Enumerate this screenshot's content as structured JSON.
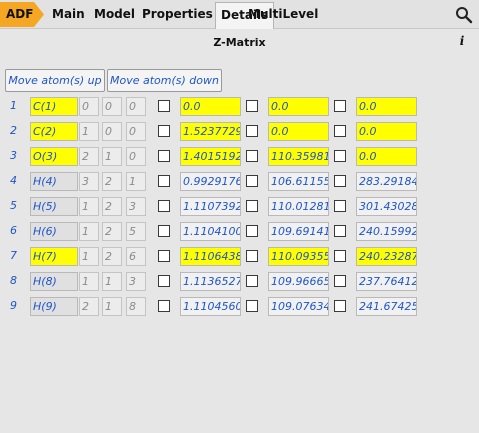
{
  "tabs": {
    "adf": "ADF",
    "items": [
      "Main",
      "Model",
      "Properties",
      "Details",
      "MultiLevel"
    ]
  },
  "panel": {
    "title": "Z-Matrix",
    "info": "i"
  },
  "toolbar": {
    "move_up": "Move atom(s) up",
    "move_down": "Move atom(s) down"
  },
  "colors": {
    "highlight": "#ffff00",
    "link_blue": "#1f55c8",
    "adf_orange": "#f5a623"
  },
  "rows": [
    {
      "n": "1",
      "atom": "C(1)",
      "r1": "0",
      "r2": "0",
      "r3": "0",
      "dist": "0.0",
      "angle": "0.0",
      "dihedral": "0.0",
      "hl_atom": true,
      "hl_dist": true,
      "hl_angle": true,
      "hl_dihedral": true
    },
    {
      "n": "2",
      "atom": "C(2)",
      "r1": "1",
      "r2": "0",
      "r3": "0",
      "dist": "1.5237729",
      "angle": "0.0",
      "dihedral": "0.0",
      "hl_atom": true,
      "hl_dist": true,
      "hl_angle": true,
      "hl_dihedral": true
    },
    {
      "n": "3",
      "atom": "O(3)",
      "r1": "2",
      "r2": "1",
      "r3": "0",
      "dist": "1.4015192",
      "angle": "110.35981",
      "dihedral": "0.0",
      "hl_atom": true,
      "hl_dist": true,
      "hl_angle": true,
      "hl_dihedral": true
    },
    {
      "n": "4",
      "atom": "H(4)",
      "r1": "3",
      "r2": "2",
      "r3": "1",
      "dist": "0.9929176",
      "angle": "106.61155",
      "dihedral": "283.29184",
      "hl_atom": false,
      "hl_dist": false,
      "hl_angle": false,
      "hl_dihedral": false
    },
    {
      "n": "5",
      "atom": "H(5)",
      "r1": "1",
      "r2": "2",
      "r3": "3",
      "dist": "1.1107392",
      "angle": "110.01281",
      "dihedral": "301.43028",
      "hl_atom": false,
      "hl_dist": false,
      "hl_angle": false,
      "hl_dihedral": false
    },
    {
      "n": "6",
      "atom": "H(6)",
      "r1": "1",
      "r2": "2",
      "r3": "5",
      "dist": "1.1104100",
      "angle": "109.69141",
      "dihedral": "240.15992",
      "hl_atom": false,
      "hl_dist": false,
      "hl_angle": false,
      "hl_dihedral": false
    },
    {
      "n": "7",
      "atom": "H(7)",
      "r1": "1",
      "r2": "2",
      "r3": "6",
      "dist": "1.1106438",
      "angle": "110.09355",
      "dihedral": "240.23287",
      "hl_atom": true,
      "hl_dist": true,
      "hl_angle": true,
      "hl_dihedral": true
    },
    {
      "n": "8",
      "atom": "H(8)",
      "r1": "1",
      "r2": "1",
      "r3": "3",
      "dist": "1.1136527",
      "angle": "109.96665",
      "dihedral": "237.76412",
      "hl_atom": false,
      "hl_dist": false,
      "hl_angle": false,
      "hl_dihedral": false
    },
    {
      "n": "9",
      "atom": "H(9)",
      "r1": "2",
      "r2": "1",
      "r3": "8",
      "dist": "1.1104560",
      "angle": "109.07634",
      "dihedral": "241.67425",
      "hl_atom": false,
      "hl_dist": false,
      "hl_angle": false,
      "hl_dihedral": false
    }
  ]
}
